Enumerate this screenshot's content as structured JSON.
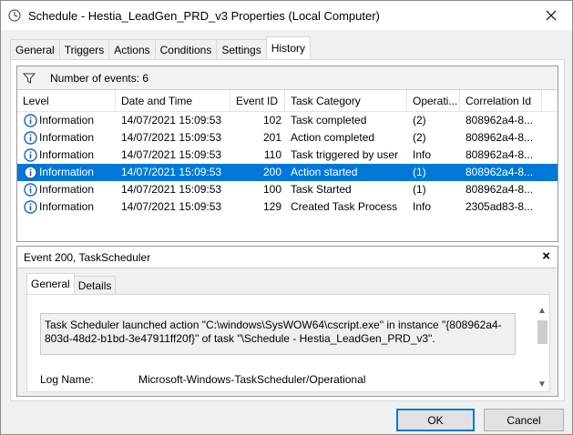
{
  "window": {
    "title": "Schedule - Hestia_LeadGen_PRD_v3 Properties (Local Computer)"
  },
  "tabs": [
    {
      "label": "General"
    },
    {
      "label": "Triggers"
    },
    {
      "label": "Actions"
    },
    {
      "label": "Conditions"
    },
    {
      "label": "Settings"
    },
    {
      "label": "History",
      "active": true
    }
  ],
  "history": {
    "event_count": "Number of events: 6",
    "columns": [
      "Level",
      "Date and Time",
      "Event ID",
      "Task Category",
      "Operati...",
      "Correlation Id"
    ],
    "rows": [
      {
        "level": "Information",
        "datetime": "14/07/2021 15:09:53",
        "event_id": "102",
        "category": "Task completed",
        "opcode": "(2)",
        "correlation": "808962a4-8..."
      },
      {
        "level": "Information",
        "datetime": "14/07/2021 15:09:53",
        "event_id": "201",
        "category": "Action completed",
        "opcode": "(2)",
        "correlation": "808962a4-8..."
      },
      {
        "level": "Information",
        "datetime": "14/07/2021 15:09:53",
        "event_id": "110",
        "category": "Task triggered by user",
        "opcode": "Info",
        "correlation": "808962a4-8..."
      },
      {
        "level": "Information",
        "datetime": "14/07/2021 15:09:53",
        "event_id": "200",
        "category": "Action started",
        "opcode": "(1)",
        "correlation": "808962a4-8...",
        "selected": true
      },
      {
        "level": "Information",
        "datetime": "14/07/2021 15:09:53",
        "event_id": "100",
        "category": "Task Started",
        "opcode": "(1)",
        "correlation": "808962a4-8..."
      },
      {
        "level": "Information",
        "datetime": "14/07/2021 15:09:53",
        "event_id": "129",
        "category": "Created Task Process",
        "opcode": "Info",
        "correlation": "2305ad83-8..."
      }
    ]
  },
  "detail": {
    "title": "Event 200, TaskScheduler",
    "close_glyph": "×",
    "tabs": [
      {
        "label": "General",
        "active": true
      },
      {
        "label": "Details"
      }
    ],
    "message": "Task Scheduler launched action \"C:\\windows\\SysWOW64\\cscript.exe\" in instance \"{808962a4-803d-48d2-b1bd-3e47911ff20f}\" of task \"\\Schedule - Hestia_LeadGen_PRD_v3\".",
    "log_name_label": "Log Name:",
    "log_name_value": "Microsoft-Windows-TaskScheduler/Operational"
  },
  "buttons": {
    "ok": "OK",
    "cancel": "Cancel"
  },
  "colors": {
    "selection": "#0078d7",
    "info_icon": "#1f5fbf"
  }
}
